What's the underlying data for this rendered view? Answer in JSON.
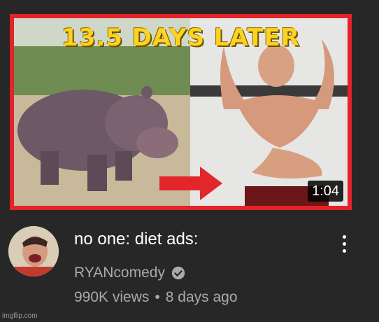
{
  "video": {
    "thumbnail_text": "13.5 DAYS LATER",
    "duration": "1:04",
    "title": "no one: diet ads:",
    "channel": "RYANcomedy",
    "views": "990K views",
    "separator": "•",
    "age": "8 days ago"
  },
  "icons": {
    "verified": "verified-check-icon",
    "more": "more-vertical-icon",
    "arrow": "red-arrow-right-icon"
  },
  "colors": {
    "background": "#272727",
    "thumbnail_border": "#e3222a",
    "thumbnail_text": "#ffd21f",
    "title": "#ffffff",
    "secondary_text": "#aaaaaa"
  },
  "watermark": "imgflip.com"
}
